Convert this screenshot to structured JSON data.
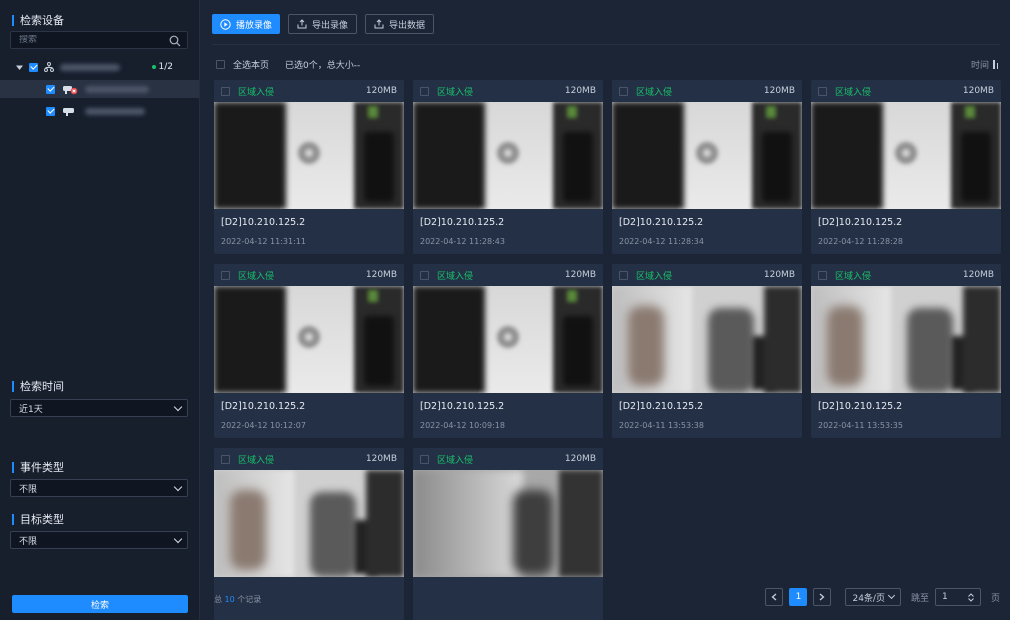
{
  "sidebar": {
    "device_title": "检索设备",
    "search_placeholder": "搜索",
    "online_count": "1/2",
    "time_title": "检索时间",
    "time_value": "近1天",
    "event_title": "事件类型",
    "event_value": "不限",
    "target_title": "目标类型",
    "target_value": "不限",
    "search_button": "检索"
  },
  "toolbar": {
    "play_label": "播放录像",
    "export_video_label": "导出录像",
    "export_data_label": "导出数据"
  },
  "selection": {
    "select_page_label": "全选本页",
    "selected_summary": "已选0个，总大小--",
    "time_sort_label": "时间"
  },
  "records": [
    {
      "tag": "区域入侵",
      "size": "120MB",
      "device": "[D2]10.210.125.2",
      "time": "2022-04-12 11:31:11",
      "scene": "a"
    },
    {
      "tag": "区域入侵",
      "size": "120MB",
      "device": "[D2]10.210.125.2",
      "time": "2022-04-12 11:28:43",
      "scene": "a"
    },
    {
      "tag": "区域入侵",
      "size": "120MB",
      "device": "[D2]10.210.125.2",
      "time": "2022-04-12 11:28:34",
      "scene": "a"
    },
    {
      "tag": "区域入侵",
      "size": "120MB",
      "device": "[D2]10.210.125.2",
      "time": "2022-04-12 11:28:28",
      "scene": "a"
    },
    {
      "tag": "区域入侵",
      "size": "120MB",
      "device": "[D2]10.210.125.2",
      "time": "2022-04-12 10:12:07",
      "scene": "a"
    },
    {
      "tag": "区域入侵",
      "size": "120MB",
      "device": "[D2]10.210.125.2",
      "time": "2022-04-12 10:09:18",
      "scene": "a"
    },
    {
      "tag": "区域入侵",
      "size": "120MB",
      "device": "[D2]10.210.125.2",
      "time": "2022-04-11 13:53:38",
      "scene": "b"
    },
    {
      "tag": "区域入侵",
      "size": "120MB",
      "device": "[D2]10.210.125.2",
      "time": "2022-04-11 13:53:35",
      "scene": "b"
    },
    {
      "tag": "区域入侵",
      "size": "120MB",
      "device": "",
      "time": "",
      "scene": "b"
    },
    {
      "tag": "区域入侵",
      "size": "120MB",
      "device": "",
      "time": "",
      "scene": "c"
    }
  ],
  "pagination": {
    "total_prefix": "总",
    "total_count": "10",
    "total_suffix": "个记录",
    "current_page": "1",
    "page_size": "24条/页",
    "jump_label": "跳至",
    "jump_value": "1",
    "page_unit": "页"
  }
}
